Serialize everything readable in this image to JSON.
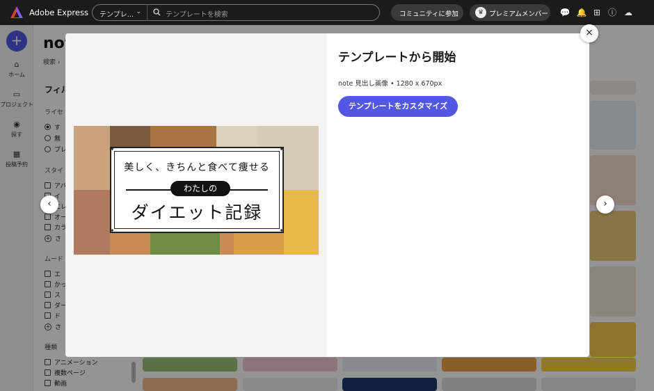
{
  "app": {
    "brand": "Adobe Express",
    "template_select": "テンプレ...",
    "search_placeholder": "テンプレートを検索",
    "community_button": "コミュニティに参加",
    "premium_button": "プレミアムメンバー"
  },
  "rail": {
    "items": [
      {
        "label": "ホーム",
        "icon": "home-icon"
      },
      {
        "label": "プロジェクト",
        "icon": "folder-icon"
      },
      {
        "label": "探す",
        "icon": "explore-icon"
      },
      {
        "label": "投稿予約",
        "icon": "calendar-icon"
      }
    ]
  },
  "page": {
    "title": "note",
    "breadcrumb": "検索",
    "filter_heading": "フィル",
    "license_label": "ライセ",
    "license_options": [
      "す",
      "無",
      "プレ"
    ],
    "style_label": "スタイ",
    "style_options": [
      "アバ",
      "イ",
      "エレ",
      "オー",
      "カラ"
    ],
    "more": "さ",
    "mood_label": "ムード",
    "mood_options": [
      "エ",
      "かっ",
      "ス",
      "ダー",
      "ド"
    ],
    "type_label": "種類",
    "type_options": [
      "アニメーション",
      "複数ページ",
      "動画"
    ]
  },
  "modal": {
    "title": "テンプレートから開始",
    "meta": "note 見出し画像 • 1280 x 670px",
    "cta": "テンプレートをカスタマイズ",
    "close": "×",
    "prev": "‹",
    "next": "›",
    "preview": {
      "line1": "美しく、きちんと食べて痩せる",
      "line2": "わたしの",
      "line3": "ダイエット記録"
    }
  },
  "colors": {
    "accent": "#5258e4",
    "topbar": "#1b1b1b"
  }
}
